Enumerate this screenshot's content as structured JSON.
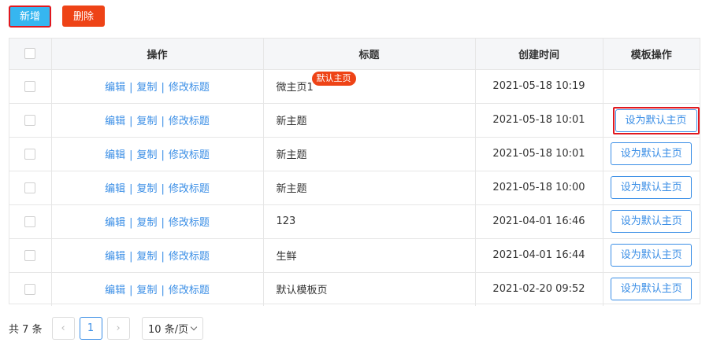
{
  "toolbar": {
    "add_label": "新增",
    "delete_label": "删除"
  },
  "table": {
    "headers": {
      "ops": "操作",
      "title": "标题",
      "created": "创建时间",
      "template_ops": "模板操作"
    },
    "op_labels": {
      "edit": "编辑",
      "copy": "复制",
      "rename": "修改标题",
      "separator": "|"
    },
    "default_badge": "默认主页",
    "set_default_label": "设为默认主页",
    "rows": [
      {
        "title": "微主页1",
        "created": "2021-05-18 10:19",
        "is_default": true
      },
      {
        "title": "新主题",
        "created": "2021-05-18 10:01",
        "is_default": false
      },
      {
        "title": "新主题",
        "created": "2021-05-18 10:01",
        "is_default": false
      },
      {
        "title": "新主题",
        "created": "2021-05-18 10:00",
        "is_default": false
      },
      {
        "title": "123",
        "created": "2021-04-01 16:46",
        "is_default": false
      },
      {
        "title": "生鲜",
        "created": "2021-04-01 16:44",
        "is_default": false
      },
      {
        "title": "默认模板页",
        "created": "2021-02-20 09:52",
        "is_default": false
      }
    ]
  },
  "pagination": {
    "total_text": "共 7 条",
    "prev_icon": "‹",
    "next_icon": "›",
    "current_page": "1",
    "page_size": "10 条/页"
  }
}
